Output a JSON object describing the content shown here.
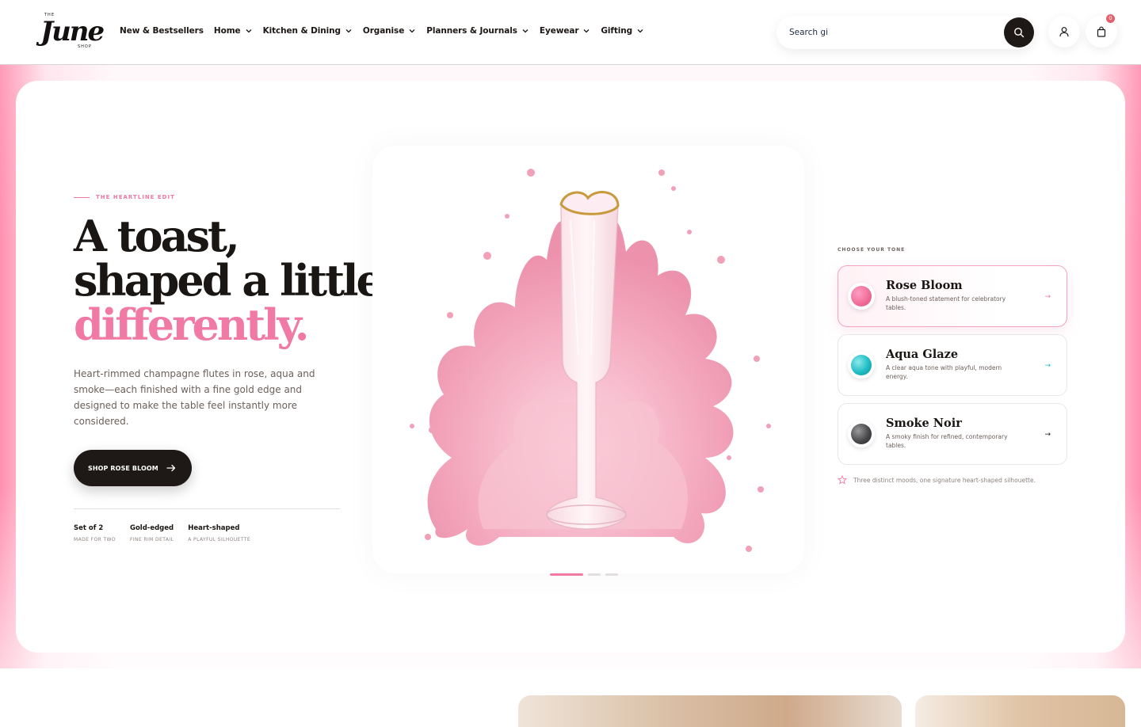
{
  "header": {
    "logo": {
      "top_text": "THE",
      "word": "June",
      "bottom_text": "SHOP"
    },
    "nav": [
      {
        "label": "New & Bestsellers",
        "has_menu": false
      },
      {
        "label": "Home",
        "has_menu": true
      },
      {
        "label": "Kitchen & Dining",
        "has_menu": true
      },
      {
        "label": "Organise",
        "has_menu": true
      },
      {
        "label": "Planners & Journals",
        "has_menu": true
      },
      {
        "label": "Eyewear",
        "has_menu": true
      },
      {
        "label": "Gifting",
        "has_menu": true
      }
    ],
    "search": {
      "value": "Search gi",
      "icon": "search-icon"
    },
    "account_icon": "user-icon",
    "cart_icon": "bag-icon",
    "cart_count": "0"
  },
  "hero": {
    "eyebrow": "THE HEARTLINE EDIT",
    "headline_line1": "A toast,",
    "headline_line2": "shaped a little",
    "headline_line3": "differently.",
    "description": "Heart-rimmed champagne flutes in rose, aqua and smoke—each finished with a fine gold edge and designed to make the table feel instantly more considered.",
    "cta_label": "SHOP ROSE BLOOM",
    "stats": [
      {
        "value": "Set of 2",
        "label": "MADE FOR TWO"
      },
      {
        "value": "Gold-edged",
        "label": "FINE RIM DETAIL"
      },
      {
        "value": "Heart-shaped",
        "label": "A PLAYFUL SILHOUETTE"
      }
    ],
    "slides_total": 3,
    "active_slide": 1
  },
  "tones": {
    "label": "CHOOSE YOUR TONE",
    "items": [
      {
        "name": "Rose Bloom",
        "desc": "A blush-toned statement for celebratory tables.",
        "color": "#f0709c",
        "arrow_color": "#f07aa3",
        "active": true
      },
      {
        "name": "Aqua Glaze",
        "desc": "A clear aqua tone with playful, modern energy.",
        "color": "#1fbcc4",
        "arrow_color": "#1fbcc4",
        "active": false
      },
      {
        "name": "Smoke Noir",
        "desc": "A smoky finish for refined, contemporary tables.",
        "color": "#4a4a4c",
        "arrow_color": "#1a1614",
        "active": false
      }
    ],
    "note": "Three distinct moods, one signature heart-shaped silhouette."
  },
  "colors": {
    "accent_pink": "#f07aa3",
    "dark": "#1e1917",
    "text_muted": "#6b5f5a"
  }
}
